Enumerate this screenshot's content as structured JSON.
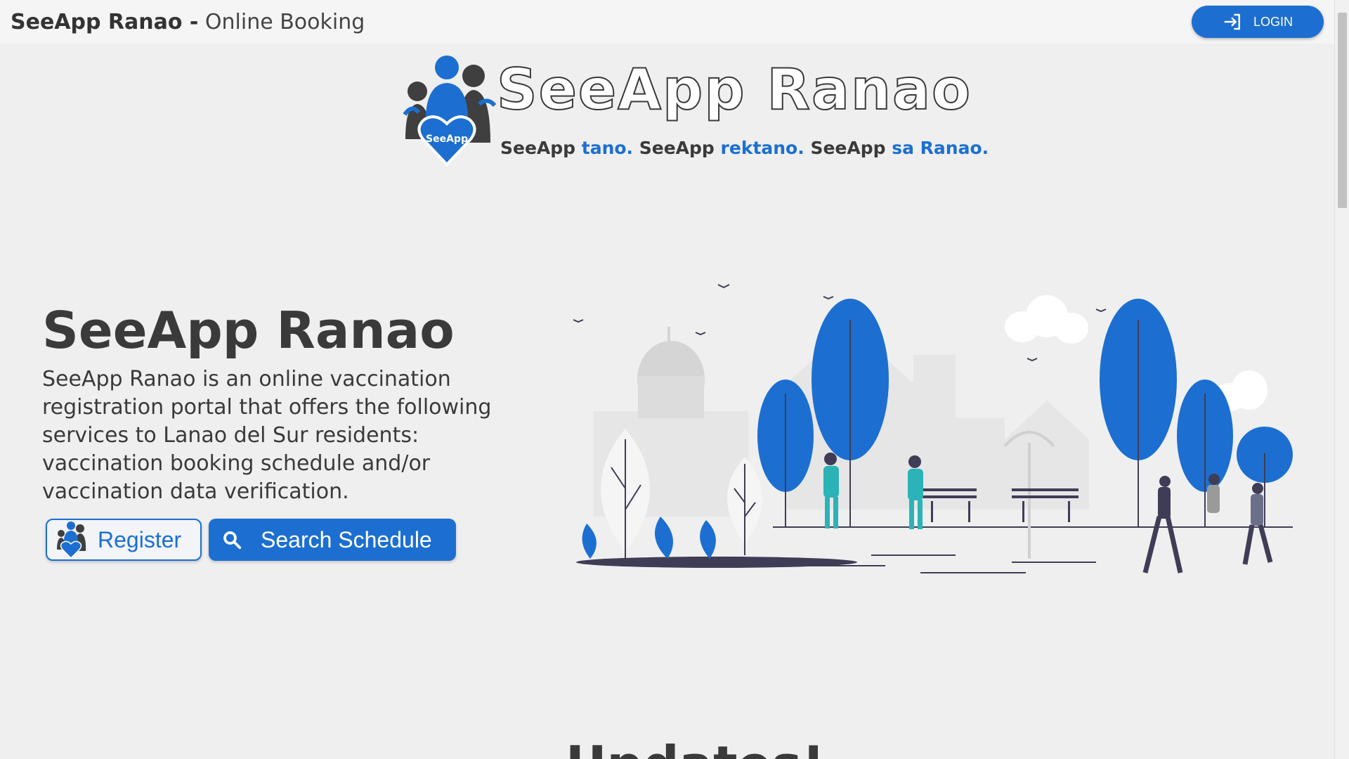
{
  "header": {
    "brand_bold": "SeeApp Ranao -",
    "brand_light": "Online Booking",
    "login_label": "LOGIN"
  },
  "logo": {
    "title": "SeeApp Ranao",
    "badge": "SeeApp",
    "tagline": [
      {
        "text": "SeeApp ",
        "blue": false
      },
      {
        "text": "tano.",
        "blue": true
      },
      {
        "text": " SeeApp ",
        "blue": false
      },
      {
        "text": "rektano.",
        "blue": true
      },
      {
        "text": " SeeApp ",
        "blue": false
      },
      {
        "text": "sa Ranao.",
        "blue": true
      }
    ]
  },
  "hero": {
    "title": "SeeApp Ranao",
    "description": "SeeApp Ranao is an online vaccination registration portal that offers the following services to Lanao del Sur residents: vaccination booking schedule and/or vaccination data verification.",
    "register_label": "Register",
    "search_label": "Search Schedule"
  },
  "section": {
    "updates_title": "Updates!"
  },
  "colors": {
    "accent": "#1c6fd0",
    "text": "#3a3a3a",
    "background": "#efefef"
  },
  "icons": [
    "login-icon",
    "seeapp-logo-icon",
    "search-icon"
  ]
}
